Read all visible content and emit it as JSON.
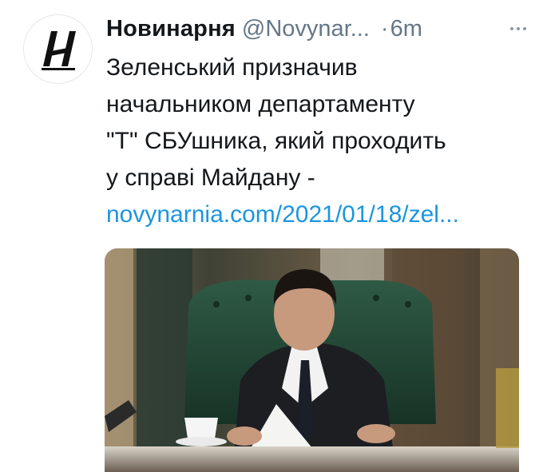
{
  "tweet": {
    "display_name": "Новинарня",
    "handle": "@Novynar...",
    "dot": "·",
    "time": "6m",
    "text_lines": [
      "Зеленський призначив",
      "начальником департаменту",
      "\"Т\" СБУшника, який проходить",
      "у справі Майдану -"
    ],
    "link": "novynarnia.com/2021/01/18/zel...",
    "avatar_icon": "novynarnia-logo-icon",
    "more_icon": "more-options-icon",
    "media_description_icon": "photo-media"
  },
  "colors": {
    "text": "#14171a",
    "secondary": "#657786",
    "link": "#1b95e0"
  }
}
